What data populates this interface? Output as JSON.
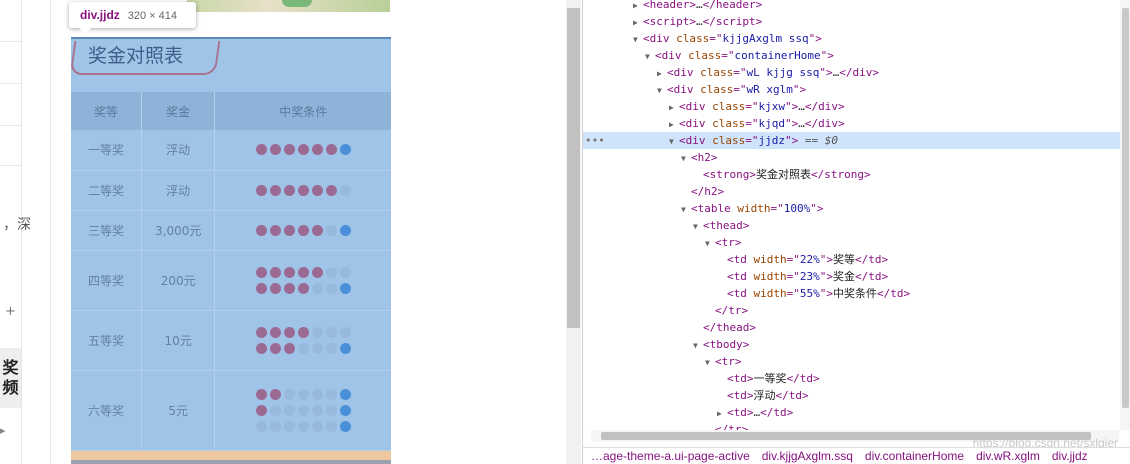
{
  "tooltip": {
    "tag": "div.jjdz",
    "dimensions": "320 × 414"
  },
  "side_fragments": {
    "deep": "，深",
    "plus": "+",
    "tab": "奖频",
    "arrow": "▸"
  },
  "prize_table": {
    "title": "奖金对照表",
    "headers": [
      "奖等",
      "奖金",
      "中奖条件"
    ],
    "rows": [
      {
        "level": "一等奖",
        "prize": "浮动",
        "balls": [
          [
            "r",
            "r",
            "r",
            "r",
            "r",
            "r",
            "b"
          ]
        ]
      },
      {
        "level": "二等奖",
        "prize": "浮动",
        "balls": [
          [
            "r",
            "r",
            "r",
            "r",
            "r",
            "r",
            "g"
          ]
        ]
      },
      {
        "level": "三等奖",
        "prize": "3,000元",
        "balls": [
          [
            "r",
            "r",
            "r",
            "r",
            "r",
            "g",
            "b"
          ]
        ]
      },
      {
        "level": "四等奖",
        "prize": "200元",
        "balls": [
          [
            "r",
            "r",
            "r",
            "r",
            "r",
            "g",
            "g"
          ],
          [
            "r",
            "r",
            "r",
            "r",
            "g",
            "g",
            "b"
          ]
        ]
      },
      {
        "level": "五等奖",
        "prize": "10元",
        "balls": [
          [
            "r",
            "r",
            "r",
            "r",
            "g",
            "g",
            "g"
          ],
          [
            "r",
            "r",
            "r",
            "g",
            "g",
            "g",
            "b"
          ]
        ]
      },
      {
        "level": "六等奖",
        "prize": "5元",
        "balls": [
          [
            "r",
            "r",
            "g",
            "g",
            "g",
            "g",
            "b"
          ],
          [
            "r",
            "g",
            "g",
            "g",
            "g",
            "g",
            "b"
          ],
          [
            "g",
            "g",
            "g",
            "g",
            "g",
            "g",
            "b"
          ]
        ]
      }
    ]
  },
  "colors": {
    "red_ball": "#9a6a93",
    "blue_ball": "#4a90d8",
    "empty_ball": "#97b9de",
    "table_bg": "#a0c4e8",
    "selected_line": "#cfe3fb"
  },
  "devtools": {
    "lines": [
      {
        "indent": 3,
        "tri": "▶",
        "html": "<span class='t-tag'>&lt;header&gt;</span>…<span class='t-tag'>&lt;/header&gt;</span>"
      },
      {
        "indent": 3,
        "tri": "▶",
        "html": "<span class='t-tag'>&lt;script&gt;</span>…<span class='t-tag'>&lt;/script&gt;</span>"
      },
      {
        "indent": 3,
        "tri": "▼",
        "html": "<span class='t-tag'>&lt;div </span><span class='t-attr'>class</span><span class='t-tag'>=\"</span><span class='t-val'>kjjgAxglm ssq</span><span class='t-tag'>\"&gt;</span>"
      },
      {
        "indent": 4,
        "tri": "▼",
        "html": "<span class='t-tag'>&lt;div </span><span class='t-attr'>class</span><span class='t-tag'>=\"</span><span class='t-val'>containerHome</span><span class='t-tag'>\"&gt;</span>"
      },
      {
        "indent": 5,
        "tri": "▶",
        "html": "<span class='t-tag'>&lt;div </span><span class='t-attr'>class</span><span class='t-tag'>=\"</span><span class='t-val'>wL kjjg ssq</span><span class='t-tag'>\"&gt;</span>…<span class='t-tag'>&lt;/div&gt;</span>"
      },
      {
        "indent": 5,
        "tri": "▼",
        "html": "<span class='t-tag'>&lt;div </span><span class='t-attr'>class</span><span class='t-tag'>=\"</span><span class='t-val'>wR xglm</span><span class='t-tag'>\"&gt;</span>"
      },
      {
        "indent": 6,
        "tri": "▶",
        "html": "<span class='t-tag'>&lt;div </span><span class='t-attr'>class</span><span class='t-tag'>=\"</span><span class='t-val'>kjxw</span><span class='t-tag'>\"&gt;</span>…<span class='t-tag'>&lt;/div&gt;</span>"
      },
      {
        "indent": 6,
        "tri": "▶",
        "html": "<span class='t-tag'>&lt;div </span><span class='t-attr'>class</span><span class='t-tag'>=\"</span><span class='t-val'>kjqd</span><span class='t-tag'>\"&gt;</span>…<span class='t-tag'>&lt;/div&gt;</span>"
      },
      {
        "indent": 6,
        "tri": "▼",
        "selected": true,
        "html": "<span class='t-tag'>&lt;div </span><span class='t-attr'>class</span><span class='t-tag'>=\"</span><span class='t-val'>jjdz</span><span class='t-tag'>\"&gt;</span> <span class='t-eq'>== $0</span>"
      },
      {
        "indent": 7,
        "tri": "▼",
        "html": "<span class='t-tag'>&lt;h2&gt;</span>"
      },
      {
        "indent": 8,
        "tri": "",
        "html": "<span class='t-tag'>&lt;strong&gt;</span><span class='t-text'>奖金对照表</span><span class='t-tag'>&lt;/strong&gt;</span>"
      },
      {
        "indent": 7,
        "tri": "",
        "html": "<span class='t-tag'>&lt;/h2&gt;</span>"
      },
      {
        "indent": 7,
        "tri": "▼",
        "html": "<span class='t-tag'>&lt;table </span><span class='t-attr'>width</span><span class='t-tag'>=\"</span><span class='t-val'>100%</span><span class='t-tag'>\"&gt;</span>"
      },
      {
        "indent": 8,
        "tri": "▼",
        "html": "<span class='t-tag'>&lt;thead&gt;</span>"
      },
      {
        "indent": 9,
        "tri": "▼",
        "html": "<span class='t-tag'>&lt;tr&gt;</span>"
      },
      {
        "indent": 10,
        "tri": "",
        "html": "<span class='t-tag'>&lt;td </span><span class='t-attr'>width</span><span class='t-tag'>=\"</span><span class='t-val'>22%</span><span class='t-tag'>\"&gt;</span><span class='t-text'>奖等</span><span class='t-tag'>&lt;/td&gt;</span>"
      },
      {
        "indent": 10,
        "tri": "",
        "html": "<span class='t-tag'>&lt;td </span><span class='t-attr'>width</span><span class='t-tag'>=\"</span><span class='t-val'>23%</span><span class='t-tag'>\"&gt;</span><span class='t-text'>奖金</span><span class='t-tag'>&lt;/td&gt;</span>"
      },
      {
        "indent": 10,
        "tri": "",
        "html": "<span class='t-tag'>&lt;td </span><span class='t-attr'>width</span><span class='t-tag'>=\"</span><span class='t-val'>55%</span><span class='t-tag'>\"&gt;</span><span class='t-text'>中奖条件</span><span class='t-tag'>&lt;/td&gt;</span>"
      },
      {
        "indent": 9,
        "tri": "",
        "html": "<span class='t-tag'>&lt;/tr&gt;</span>"
      },
      {
        "indent": 8,
        "tri": "",
        "html": "<span class='t-tag'>&lt;/thead&gt;</span>"
      },
      {
        "indent": 8,
        "tri": "▼",
        "html": "<span class='t-tag'>&lt;tbody&gt;</span>"
      },
      {
        "indent": 9,
        "tri": "▼",
        "html": "<span class='t-tag'>&lt;tr&gt;</span>"
      },
      {
        "indent": 10,
        "tri": "",
        "html": "<span class='t-tag'>&lt;td&gt;</span><span class='t-text'>一等奖</span><span class='t-tag'>&lt;/td&gt;</span>"
      },
      {
        "indent": 10,
        "tri": "",
        "html": "<span class='t-tag'>&lt;td&gt;</span><span class='t-text'>浮动</span><span class='t-tag'>&lt;/td&gt;</span>"
      },
      {
        "indent": 10,
        "tri": "▶",
        "html": "<span class='t-tag'>&lt;td&gt;</span>…<span class='t-tag'>&lt;/td&gt;</span>"
      },
      {
        "indent": 9,
        "tri": "",
        "html": "<span class='t-tag'>&lt;/tr&gt;</span>"
      }
    ],
    "breadcrumbs": [
      "…age-theme-a.ui-page-active",
      "div.kjjgAxglm.ssq",
      "div.containerHome",
      "div.wR.xglm",
      "div.jjdz"
    ],
    "dots": "•••",
    "watermark": "https://blog.csdn.net/sxlgjer"
  }
}
